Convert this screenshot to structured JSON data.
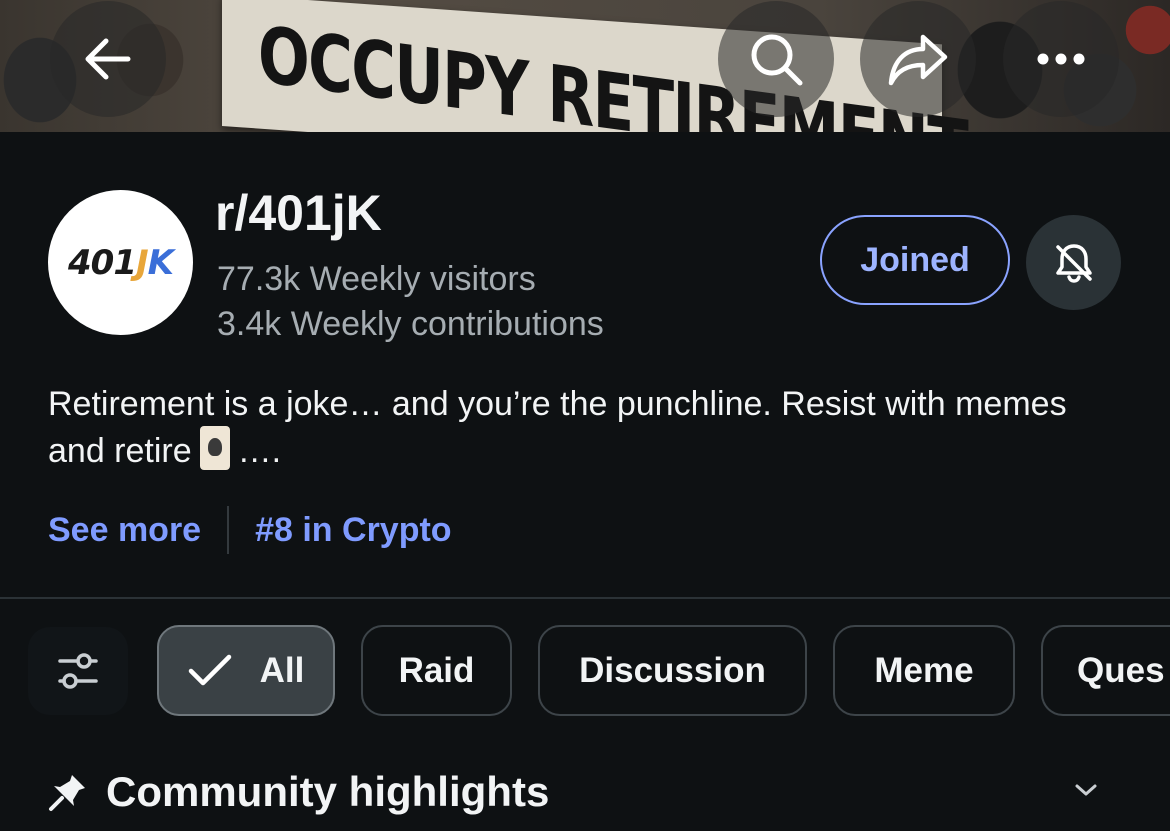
{
  "banner": {
    "sign_text": "OCCUPY RETIREMENT"
  },
  "header": {
    "back_icon": "arrow-left-icon",
    "search_icon": "search-icon",
    "share_icon": "share-icon",
    "more_icon": "more-horizontal-icon"
  },
  "community": {
    "avatar_text_a": "401",
    "avatar_text_j": "J",
    "avatar_text_k": "K",
    "name": "r/401jK",
    "weekly_visitors": "77.3k Weekly visitors",
    "weekly_contributions": "3.4k Weekly contributions",
    "joined_label": "Joined",
    "bell_icon": "bell-off-icon",
    "description_part1": "Retirement is a joke… and you’re the punchline. Resist with memes and retire",
    "description_part2": "….",
    "see_more": "See more",
    "rank": "#8 in Crypto"
  },
  "filters": {
    "filter_icon": "sliders-icon",
    "chips": [
      {
        "label": "All",
        "active": true
      },
      {
        "label": "Raid",
        "active": false
      },
      {
        "label": "Discussion",
        "active": false
      },
      {
        "label": "Meme",
        "active": false
      },
      {
        "label": "Ques",
        "active": false
      }
    ]
  },
  "highlights": {
    "title": "Community highlights",
    "pin_icon": "pin-icon",
    "chevron_icon": "chevron-down-icon"
  },
  "colors": {
    "background": "#0e1113",
    "accent": "#7f9bff",
    "secondary_text": "#a6adb2"
  }
}
